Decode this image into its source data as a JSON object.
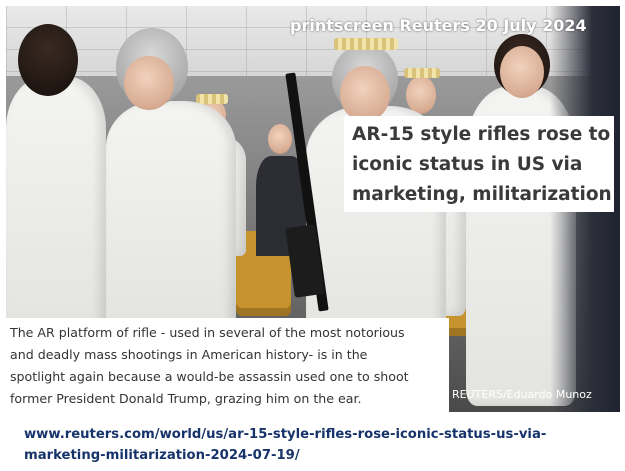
{
  "stamp": "printscreen Reuters 20 July 2024",
  "headline": {
    "lines": [
      "AR-15 style rifles rose to",
      "iconic status in US via",
      "marketing, militarization"
    ]
  },
  "caption": {
    "lines": [
      "The AR platform of rifle - used in several of the most notorious",
      "and deadly mass shootings in American history- is in the",
      "spotlight again because a would-be assassin used one to shoot",
      "former President Donald Trump, grazing him on the ear."
    ]
  },
  "credit": "REUTERS/Eduardo Munoz",
  "url": {
    "lines": [
      "www.reuters.com/world/us/ar-15-style-rifles-rose-iconic-status-us-via-",
      "marketing-militarization-2024-07-19/"
    ]
  },
  "colors": {
    "url_text": "#17336b",
    "headline_text": "#3a3a3a",
    "caption_text": "#333333",
    "stamp_text": "#ffffff"
  }
}
